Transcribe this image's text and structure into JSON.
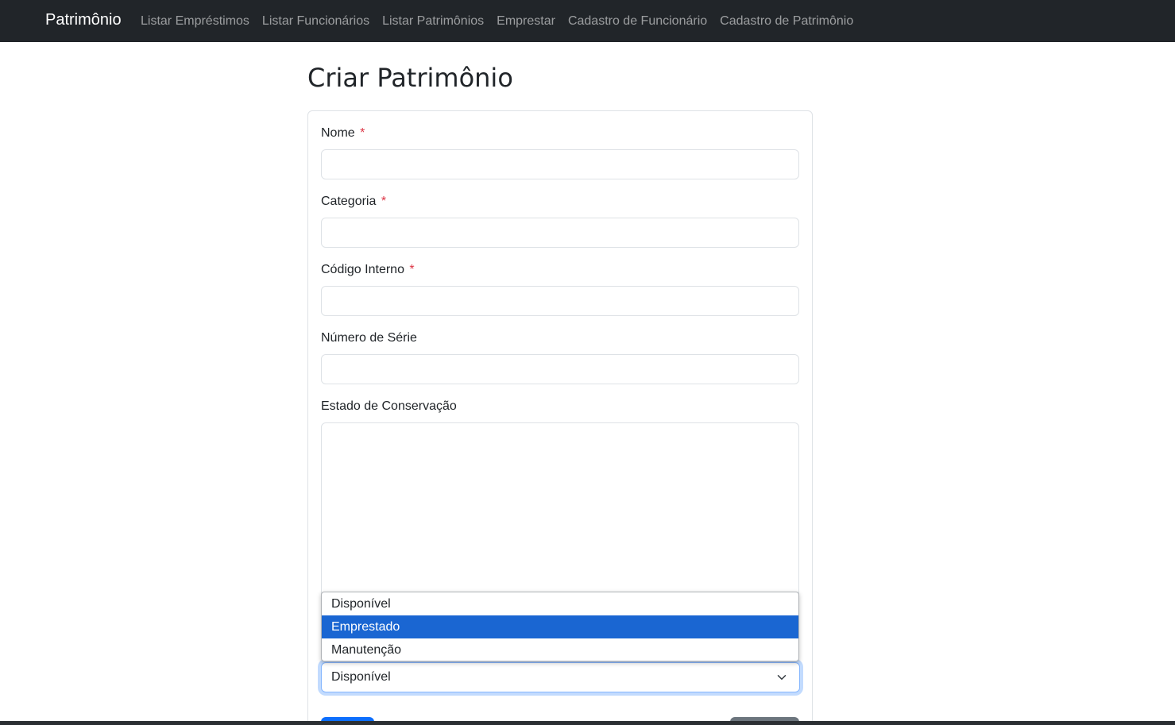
{
  "navbar": {
    "brand": "Patrimônio",
    "links": [
      "Listar Empréstimos",
      "Listar Funcionários",
      "Listar Patrimônios",
      "Emprestar",
      "Cadastro de Funcionário",
      "Cadastro de Patrimônio"
    ]
  },
  "page": {
    "title": "Criar Patrimônio"
  },
  "form": {
    "fields": {
      "nome": {
        "label": "Nome",
        "required_mark": "*",
        "value": ""
      },
      "categoria": {
        "label": "Categoria",
        "required_mark": "*",
        "value": ""
      },
      "codigo_interno": {
        "label": "Código Interno",
        "required_mark": "*",
        "value": ""
      },
      "numero_serie": {
        "label": "Número de Série",
        "value": ""
      },
      "estado_conservacao": {
        "label": "Estado de Conservação",
        "value": ""
      }
    },
    "status_select": {
      "value": "Disponível",
      "options": [
        "Disponível",
        "Emprestado",
        "Manutenção"
      ],
      "highlighted": "Emprestado"
    }
  },
  "colors": {
    "navbar_bg": "#212529",
    "required": "#dc3545",
    "option_highlight": "#1a66d2",
    "primary": "#0d6efd",
    "secondary": "#6c757d"
  }
}
